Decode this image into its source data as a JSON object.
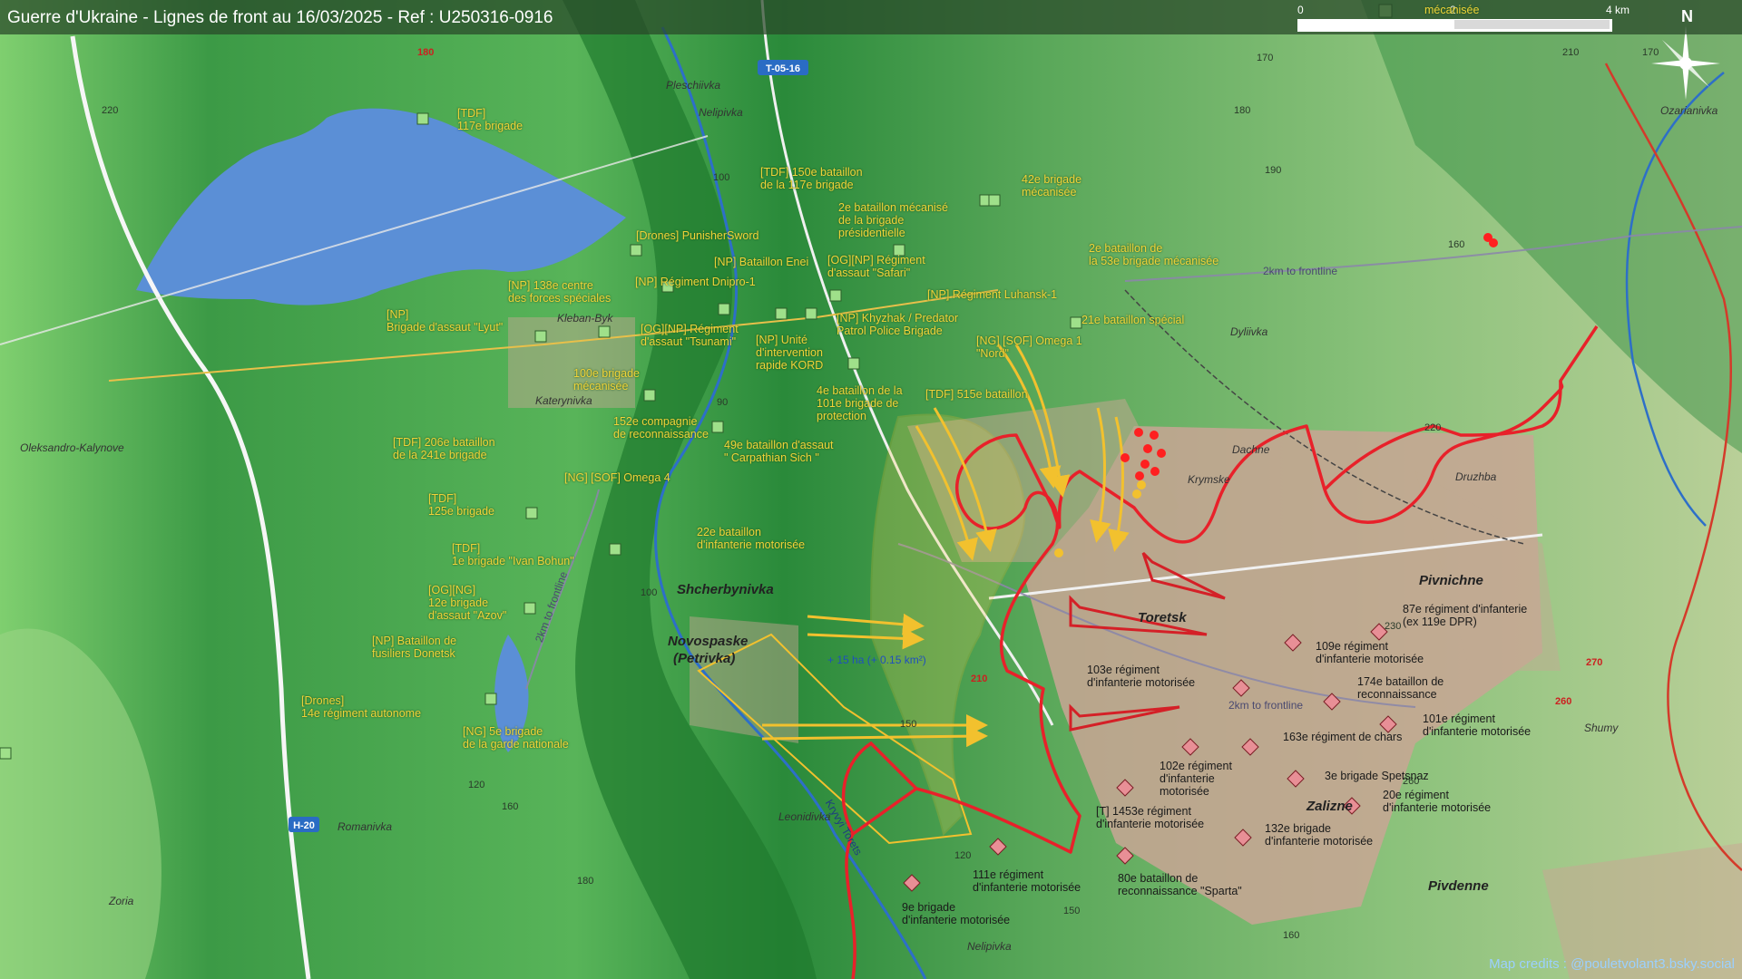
{
  "title": "Guerre d'Ukraine - Lignes de front au 16/03/2025 - Ref : U250316-0916",
  "credits": "Map credits : @pouletvolant3.bsky.social",
  "scale": {
    "start": "0",
    "mid": "2",
    "end": "4 km"
  },
  "north": "N",
  "colors": {
    "front_line": "#e8212a",
    "advance_arrow": "#f2c12e",
    "russian_arrow": "#d42027",
    "ukr_unit": "#9fe08a",
    "ru_unit": "#e88f96",
    "water": "#5b8fd6",
    "built_area": "#c9a695"
  },
  "places": [
    {
      "id": "pleschiivka",
      "text": "Pleschiivka"
    },
    {
      "id": "nelipivka_n",
      "text": "Nelipivka"
    },
    {
      "id": "kleban_byk",
      "text": "Kleban-Byk"
    },
    {
      "id": "katerynivka",
      "text": "Katerynivka"
    },
    {
      "id": "oleksandro",
      "text": "Oleksandro-Kalynove"
    },
    {
      "id": "shcherbynivka",
      "text": "Shcherbynivka"
    },
    {
      "id": "novospaske",
      "text": "Novospaske"
    },
    {
      "id": "petrivka",
      "text": "(Petrivka)"
    },
    {
      "id": "leonidivka",
      "text": "Leonidivka"
    },
    {
      "id": "romanivka",
      "text": "Romanivka"
    },
    {
      "id": "zoria",
      "text": "Zoria"
    },
    {
      "id": "nelipivka_s",
      "text": "Nelipivka"
    },
    {
      "id": "dyliivka",
      "text": "Dyliivka"
    },
    {
      "id": "dachne",
      "text": "Dachne"
    },
    {
      "id": "krymske",
      "text": "Krymske"
    },
    {
      "id": "druzhba",
      "text": "Druzhba"
    },
    {
      "id": "toretsk",
      "text": "Toretsk"
    },
    {
      "id": "pivnichne",
      "text": "Pivnichne"
    },
    {
      "id": "zalizne",
      "text": "Zalizne"
    },
    {
      "id": "pivdenne",
      "text": "Pivdenne"
    },
    {
      "id": "shumy",
      "text": "Shumy"
    },
    {
      "id": "ozarianivka",
      "text": "Ozarianivka"
    }
  ],
  "roads": [
    {
      "id": "t0516",
      "text": "T-05-16"
    },
    {
      "id": "h20",
      "text": "H-20"
    }
  ],
  "elevations": [
    {
      "id": "e1",
      "text": "180"
    },
    {
      "id": "e2",
      "text": "220"
    },
    {
      "id": "e3",
      "text": "100"
    },
    {
      "id": "e4",
      "text": "90"
    },
    {
      "id": "e5",
      "text": "100"
    },
    {
      "id": "e6",
      "text": "120"
    },
    {
      "id": "e7",
      "text": "160"
    },
    {
      "id": "e8",
      "text": "180"
    },
    {
      "id": "e9",
      "text": "120"
    },
    {
      "id": "e10",
      "text": "150"
    },
    {
      "id": "e11",
      "text": "150"
    },
    {
      "id": "e12",
      "text": "210"
    },
    {
      "id": "e13",
      "text": "170"
    },
    {
      "id": "e14",
      "text": "180"
    },
    {
      "id": "e15",
      "text": "190"
    },
    {
      "id": "e16",
      "text": "170"
    },
    {
      "id": "e17",
      "text": "160"
    },
    {
      "id": "e18",
      "text": "220"
    },
    {
      "id": "e19",
      "text": "230"
    },
    {
      "id": "e20",
      "text": "270"
    },
    {
      "id": "e21",
      "text": "260"
    },
    {
      "id": "e22",
      "text": "260"
    },
    {
      "id": "e23",
      "text": "210"
    },
    {
      "id": "e24",
      "text": "160"
    }
  ],
  "frontline_labels": [
    {
      "id": "fl1",
      "text": "2km to frontline"
    },
    {
      "id": "fl2",
      "text": "2km to frontline"
    },
    {
      "id": "fl3",
      "text": "2km to frontline"
    }
  ],
  "river_label": "Kryvyi Torets",
  "area_note": "+ 15 ha (+ 0.15 km²)",
  "ukr_units": [
    {
      "id": "u1",
      "lines": [
        "[TDF]",
        "117e brigade"
      ]
    },
    {
      "id": "u2",
      "lines": [
        "[NP]",
        "Brigade d'assaut \"Lyut\""
      ]
    },
    {
      "id": "u3",
      "lines": [
        "[NP] 138e centre",
        "des forces spéciales"
      ]
    },
    {
      "id": "u4",
      "lines": [
        "[Drones] PunisherSword"
      ]
    },
    {
      "id": "u5",
      "lines": [
        "[NP] Régiment Dnipro-1"
      ]
    },
    {
      "id": "u6",
      "lines": [
        "[NP] Bataillon Enei"
      ]
    },
    {
      "id": "u7",
      "lines": [
        "[TDF] 150e bataillon",
        "de la 117e brigade"
      ]
    },
    {
      "id": "u8",
      "lines": [
        "2e bataillon mécanisé",
        "de la brigade",
        "présidentielle"
      ]
    },
    {
      "id": "u9",
      "lines": [
        "[OG][NP] Régiment",
        "d'assaut \"Safari\""
      ]
    },
    {
      "id": "u10",
      "lines": [
        "[NP] Régiment Luhansk-1"
      ]
    },
    {
      "id": "u11",
      "lines": [
        "[NP] Khyzhak / Predator",
        "Patrol Police Brigade"
      ]
    },
    {
      "id": "u12",
      "lines": [
        "[OG][NP] Régiment",
        "d'assaut \"Tsunami\""
      ]
    },
    {
      "id": "u13",
      "lines": [
        "[NP] Unité",
        "d'intervention",
        "rapide KORD"
      ]
    },
    {
      "id": "u14",
      "lines": [
        "100e brigade",
        "mécanisée"
      ]
    },
    {
      "id": "u15",
      "lines": [
        "152e compagnie",
        "de reconnaissance"
      ]
    },
    {
      "id": "u16",
      "lines": [
        "4e bataillon de la",
        "101e brigade de",
        "protection"
      ]
    },
    {
      "id": "u17",
      "lines": [
        "49e bataillon d'assaut",
        "\" Carpathian Sich \""
      ]
    },
    {
      "id": "u18",
      "lines": [
        "[TDF] 206e bataillon",
        "de la 241e brigade"
      ]
    },
    {
      "id": "u19",
      "lines": [
        "[NG] [SOF] Omega 4"
      ]
    },
    {
      "id": "u20",
      "lines": [
        "[TDF]",
        "125e brigade"
      ]
    },
    {
      "id": "u21",
      "lines": [
        "22e bataillon",
        "d'infanterie motorisée"
      ]
    },
    {
      "id": "u22",
      "lines": [
        "[TDF]",
        "1e brigade \"Ivan Bohun\""
      ]
    },
    {
      "id": "u23",
      "lines": [
        "[OG][NG]",
        "12e brigade",
        "d'assaut \"Azov\""
      ]
    },
    {
      "id": "u24",
      "lines": [
        "[NP] Bataillon de",
        "fusiliers Donetsk"
      ]
    },
    {
      "id": "u25",
      "lines": [
        "[Drones]",
        "14e régiment autonome"
      ]
    },
    {
      "id": "u26",
      "lines": [
        "[NG] 5e brigade",
        "de la garde nationale"
      ]
    },
    {
      "id": "u27",
      "lines": [
        "42e brigade",
        "mécanisée"
      ]
    },
    {
      "id": "u28",
      "lines": [
        "2e bataillon de",
        "la 53e brigade mécanisée"
      ]
    },
    {
      "id": "u29",
      "lines": [
        "21e bataillon spécial"
      ]
    },
    {
      "id": "u30",
      "lines": [
        "[NG] [SOF] Omega 1",
        "\"Nord\""
      ]
    },
    {
      "id": "u31",
      "lines": [
        "[TDF] 515e bataillon"
      ]
    },
    {
      "id": "u32",
      "lines": [
        "mécanisée"
      ]
    }
  ],
  "ru_units": [
    {
      "id": "r1",
      "lines": [
        "87e régiment d'infanterie",
        "(ex 119e DPR)"
      ]
    },
    {
      "id": "r2",
      "lines": [
        "109e régiment",
        "d'infanterie motorisée"
      ]
    },
    {
      "id": "r3",
      "lines": [
        "103e régiment",
        "d'infanterie motorisée"
      ]
    },
    {
      "id": "r4",
      "lines": [
        "174e bataillon de",
        "reconnaissance"
      ]
    },
    {
      "id": "r5",
      "lines": [
        "101e régiment",
        "d'infanterie motorisée"
      ]
    },
    {
      "id": "r6",
      "lines": [
        "163e régiment de chars"
      ]
    },
    {
      "id": "r7",
      "lines": [
        "102e régiment",
        "d'infanterie",
        "motorisée"
      ]
    },
    {
      "id": "r8",
      "lines": [
        "3e brigade Spetsnaz"
      ]
    },
    {
      "id": "r9",
      "lines": [
        "20e régiment",
        "d'infanterie motorisée"
      ]
    },
    {
      "id": "r10",
      "lines": [
        "[T] 1453e régiment",
        "d'infanterie motorisée"
      ]
    },
    {
      "id": "r11",
      "lines": [
        "132e brigade",
        "d'infanterie motorisée"
      ]
    },
    {
      "id": "r12",
      "lines": [
        "111e régiment",
        "d'infanterie motorisée"
      ]
    },
    {
      "id": "r13",
      "lines": [
        "80e bataillon de",
        "reconnaissance \"Sparta\""
      ]
    },
    {
      "id": "r14",
      "lines": [
        "9e brigade",
        "d'infanterie motorisée"
      ]
    }
  ]
}
